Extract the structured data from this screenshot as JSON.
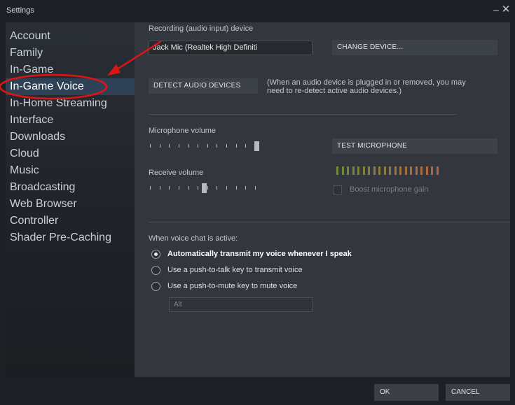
{
  "window": {
    "title": "Settings"
  },
  "sidebar": {
    "items": [
      {
        "label": "Account"
      },
      {
        "label": "Family"
      },
      {
        "label": "In-Game"
      },
      {
        "label": "In-Game Voice",
        "active": true
      },
      {
        "label": "In-Home Streaming"
      },
      {
        "label": "Interface"
      },
      {
        "label": "Downloads"
      },
      {
        "label": "Cloud"
      },
      {
        "label": "Music"
      },
      {
        "label": "Broadcasting"
      },
      {
        "label": "Web Browser"
      },
      {
        "label": "Controller"
      },
      {
        "label": "Shader Pre-Caching"
      }
    ]
  },
  "voice": {
    "recording_label": "Recording (audio input) device",
    "device_value": "Jack Mic (Realtek High Definiti",
    "change_device_label": "CHANGE DEVICE...",
    "detect_devices_label": "DETECT AUDIO DEVICES",
    "detect_note_line1": "(When an audio device is plugged in or removed, you may",
    "detect_note_line2": "need to re-detect active audio devices.)",
    "mic_volume_label": "Microphone volume",
    "mic_volume_level": 1.0,
    "test_mic_label": "TEST MICROPHONE",
    "receive_volume_label": "Receive volume",
    "receive_volume_level": 0.5,
    "boost_label": "Boost microphone gain",
    "boost_checked": false,
    "active_label": "When voice chat is active:",
    "options": [
      {
        "label": "Automatically transmit my voice whenever I speak",
        "selected": true
      },
      {
        "label": "Use a push-to-talk key to transmit voice",
        "selected": false
      },
      {
        "label": "Use a push-to-mute key to mute voice",
        "selected": false
      }
    ],
    "key_value": "Alt"
  },
  "footer": {
    "ok_label": "OK",
    "cancel_label": "CANCEL"
  },
  "colors": {
    "active_item": "#2f4255",
    "annotation_red": "#e01414",
    "meter_green": "#6e8a3c",
    "meter_orange": "#b4643c"
  }
}
